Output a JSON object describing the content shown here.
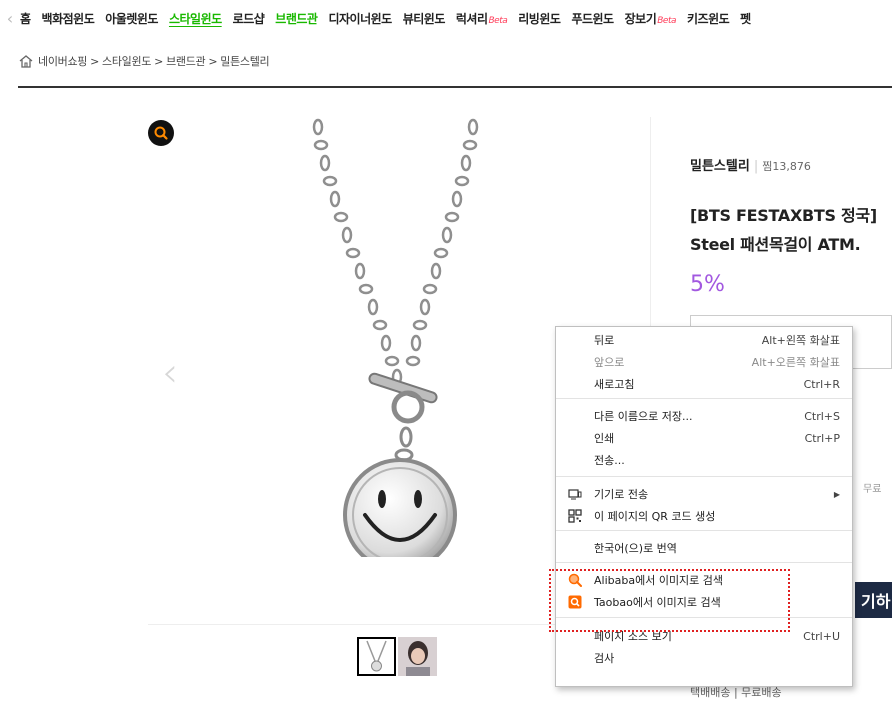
{
  "nav": {
    "items": [
      {
        "label": "홈",
        "style": "normal",
        "beta": ""
      },
      {
        "label": "백화점윈도",
        "style": "normal",
        "beta": ""
      },
      {
        "label": "아울렛윈도",
        "style": "normal",
        "beta": ""
      },
      {
        "label": "스타일윈도",
        "style": "active",
        "beta": ""
      },
      {
        "label": "로드샵",
        "style": "normal",
        "beta": ""
      },
      {
        "label": "브랜드관",
        "style": "green",
        "beta": ""
      },
      {
        "label": "디자이너윈도",
        "style": "normal",
        "beta": ""
      },
      {
        "label": "뷰티윈도",
        "style": "normal",
        "beta": ""
      },
      {
        "label": "럭셔리",
        "style": "normal",
        "beta": "Beta"
      },
      {
        "label": "리빙윈도",
        "style": "normal",
        "beta": ""
      },
      {
        "label": "푸드윈도",
        "style": "normal",
        "beta": ""
      },
      {
        "label": "장보기",
        "style": "normal",
        "beta": "Beta"
      },
      {
        "label": "키즈윈도",
        "style": "normal",
        "beta": ""
      },
      {
        "label": "펫",
        "style": "normal",
        "beta": ""
      }
    ]
  },
  "breadcrumb": {
    "items": [
      "네이버쇼핑",
      "스타일윈도",
      "브랜드관",
      "밀튼스텔리"
    ],
    "separator": ">"
  },
  "product": {
    "brand": "밀튼스텔리",
    "fav_label": "찜13,876",
    "title_line1": "[BTS FESTAXBTS 정국]",
    "title_line2": "Steel 패션목걸이 ATM.",
    "discount": "5%",
    "delivery": "택배배송 | 무료배송",
    "right_peek": "무료",
    "right_button_text": "기하"
  },
  "context_menu": {
    "items": [
      {
        "label": "뒤로",
        "shortcut": "Alt+왼쪽 화살표",
        "disabled": false,
        "icon": ""
      },
      {
        "label": "앞으로",
        "shortcut": "Alt+오른쪽 화살표",
        "disabled": true,
        "icon": ""
      },
      {
        "label": "새로고침",
        "shortcut": "Ctrl+R",
        "disabled": false,
        "icon": ""
      },
      {
        "label": "다른 이름으로 저장...",
        "shortcut": "Ctrl+S",
        "disabled": false,
        "icon": ""
      },
      {
        "label": "인쇄",
        "shortcut": "Ctrl+P",
        "disabled": false,
        "icon": ""
      },
      {
        "label": "전송...",
        "shortcut": "",
        "disabled": false,
        "icon": ""
      },
      {
        "label": "기기로 전송",
        "shortcut": "",
        "disabled": false,
        "icon": "device-icon",
        "submenu": true
      },
      {
        "label": "이 페이지의 QR 코드 생성",
        "shortcut": "",
        "disabled": false,
        "icon": "qr-code-icon"
      },
      {
        "label": "한국어(으)로 번역",
        "shortcut": "",
        "disabled": false,
        "icon": ""
      },
      {
        "label": "Alibaba에서 이미지로 검색",
        "shortcut": "",
        "disabled": false,
        "icon": "alibaba-search-icon"
      },
      {
        "label": "Taobao에서 이미지로 검색",
        "shortcut": "",
        "disabled": false,
        "icon": "taobao-search-icon"
      },
      {
        "label": "페이지 소스 보기",
        "shortcut": "Ctrl+U",
        "disabled": false,
        "icon": ""
      },
      {
        "label": "검사",
        "shortcut": "",
        "disabled": false,
        "icon": ""
      }
    ]
  },
  "colors": {
    "accent_green": "#19b800",
    "discount_purple": "#a258e0",
    "beta_red": "#ff3d5a",
    "highlight_red": "#e02020",
    "search_orange": "#ff6a00"
  }
}
